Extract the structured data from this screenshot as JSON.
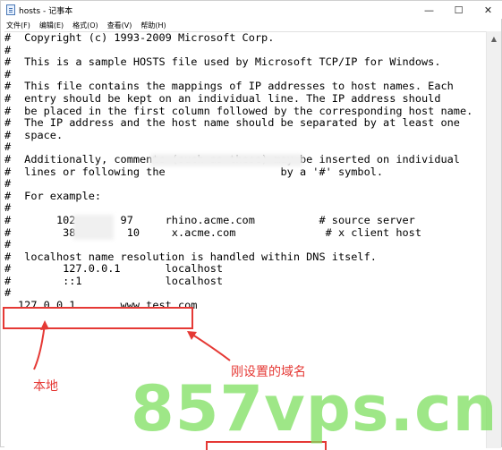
{
  "window": {
    "title": "hosts - 记事本",
    "controls": {
      "minimize": "—",
      "maximize": "☐",
      "close": "✕"
    }
  },
  "menu": [
    "文件(F)",
    "编辑(E)",
    "格式(O)",
    "查看(V)",
    "帮助(H)"
  ],
  "editor": {
    "gutter": "#\n#\n#\n#\n#\n#\n#\n#\n#\n#\n#\n#\n#\n#\n#\n#\n#\n#\n#\n#\n#\n#",
    "content": " Copyright (c) 1993-2009 Microsoft Corp.\n\n This is a sample HOSTS file used by Microsoft TCP/IP for Windows.\n\n This file contains the mappings of IP addresses to host names. Each\n entry should be kept on an individual line. The IP address should\n be placed in the first column followed by the corresponding host name.\n The IP address and the host name should be separated by at least one\n space.\n\n Additionally, comments (such as these) may be inserted on individual\n lines or following the                  by a '#' symbol.\n\n For example:\n\n      102       97     rhino.acme.com          # source server\n       38.       10     x.acme.com              # x client host\n\n localhost name resolution is handled within DNS itself.\n       127.0.0.1       localhost\n       ::1             localhost\n\n127.0.0.1       www.test.com"
  },
  "annotations": {
    "local_label": "本地",
    "domain_label": "刚设置的域名"
  },
  "watermark": "857vps.cn",
  "colors": {
    "annotation_red": "#e53935",
    "watermark_green": "#7ee05f"
  },
  "icons": {
    "app": "notepad-icon",
    "scroll_up": "chevron-up-icon"
  }
}
